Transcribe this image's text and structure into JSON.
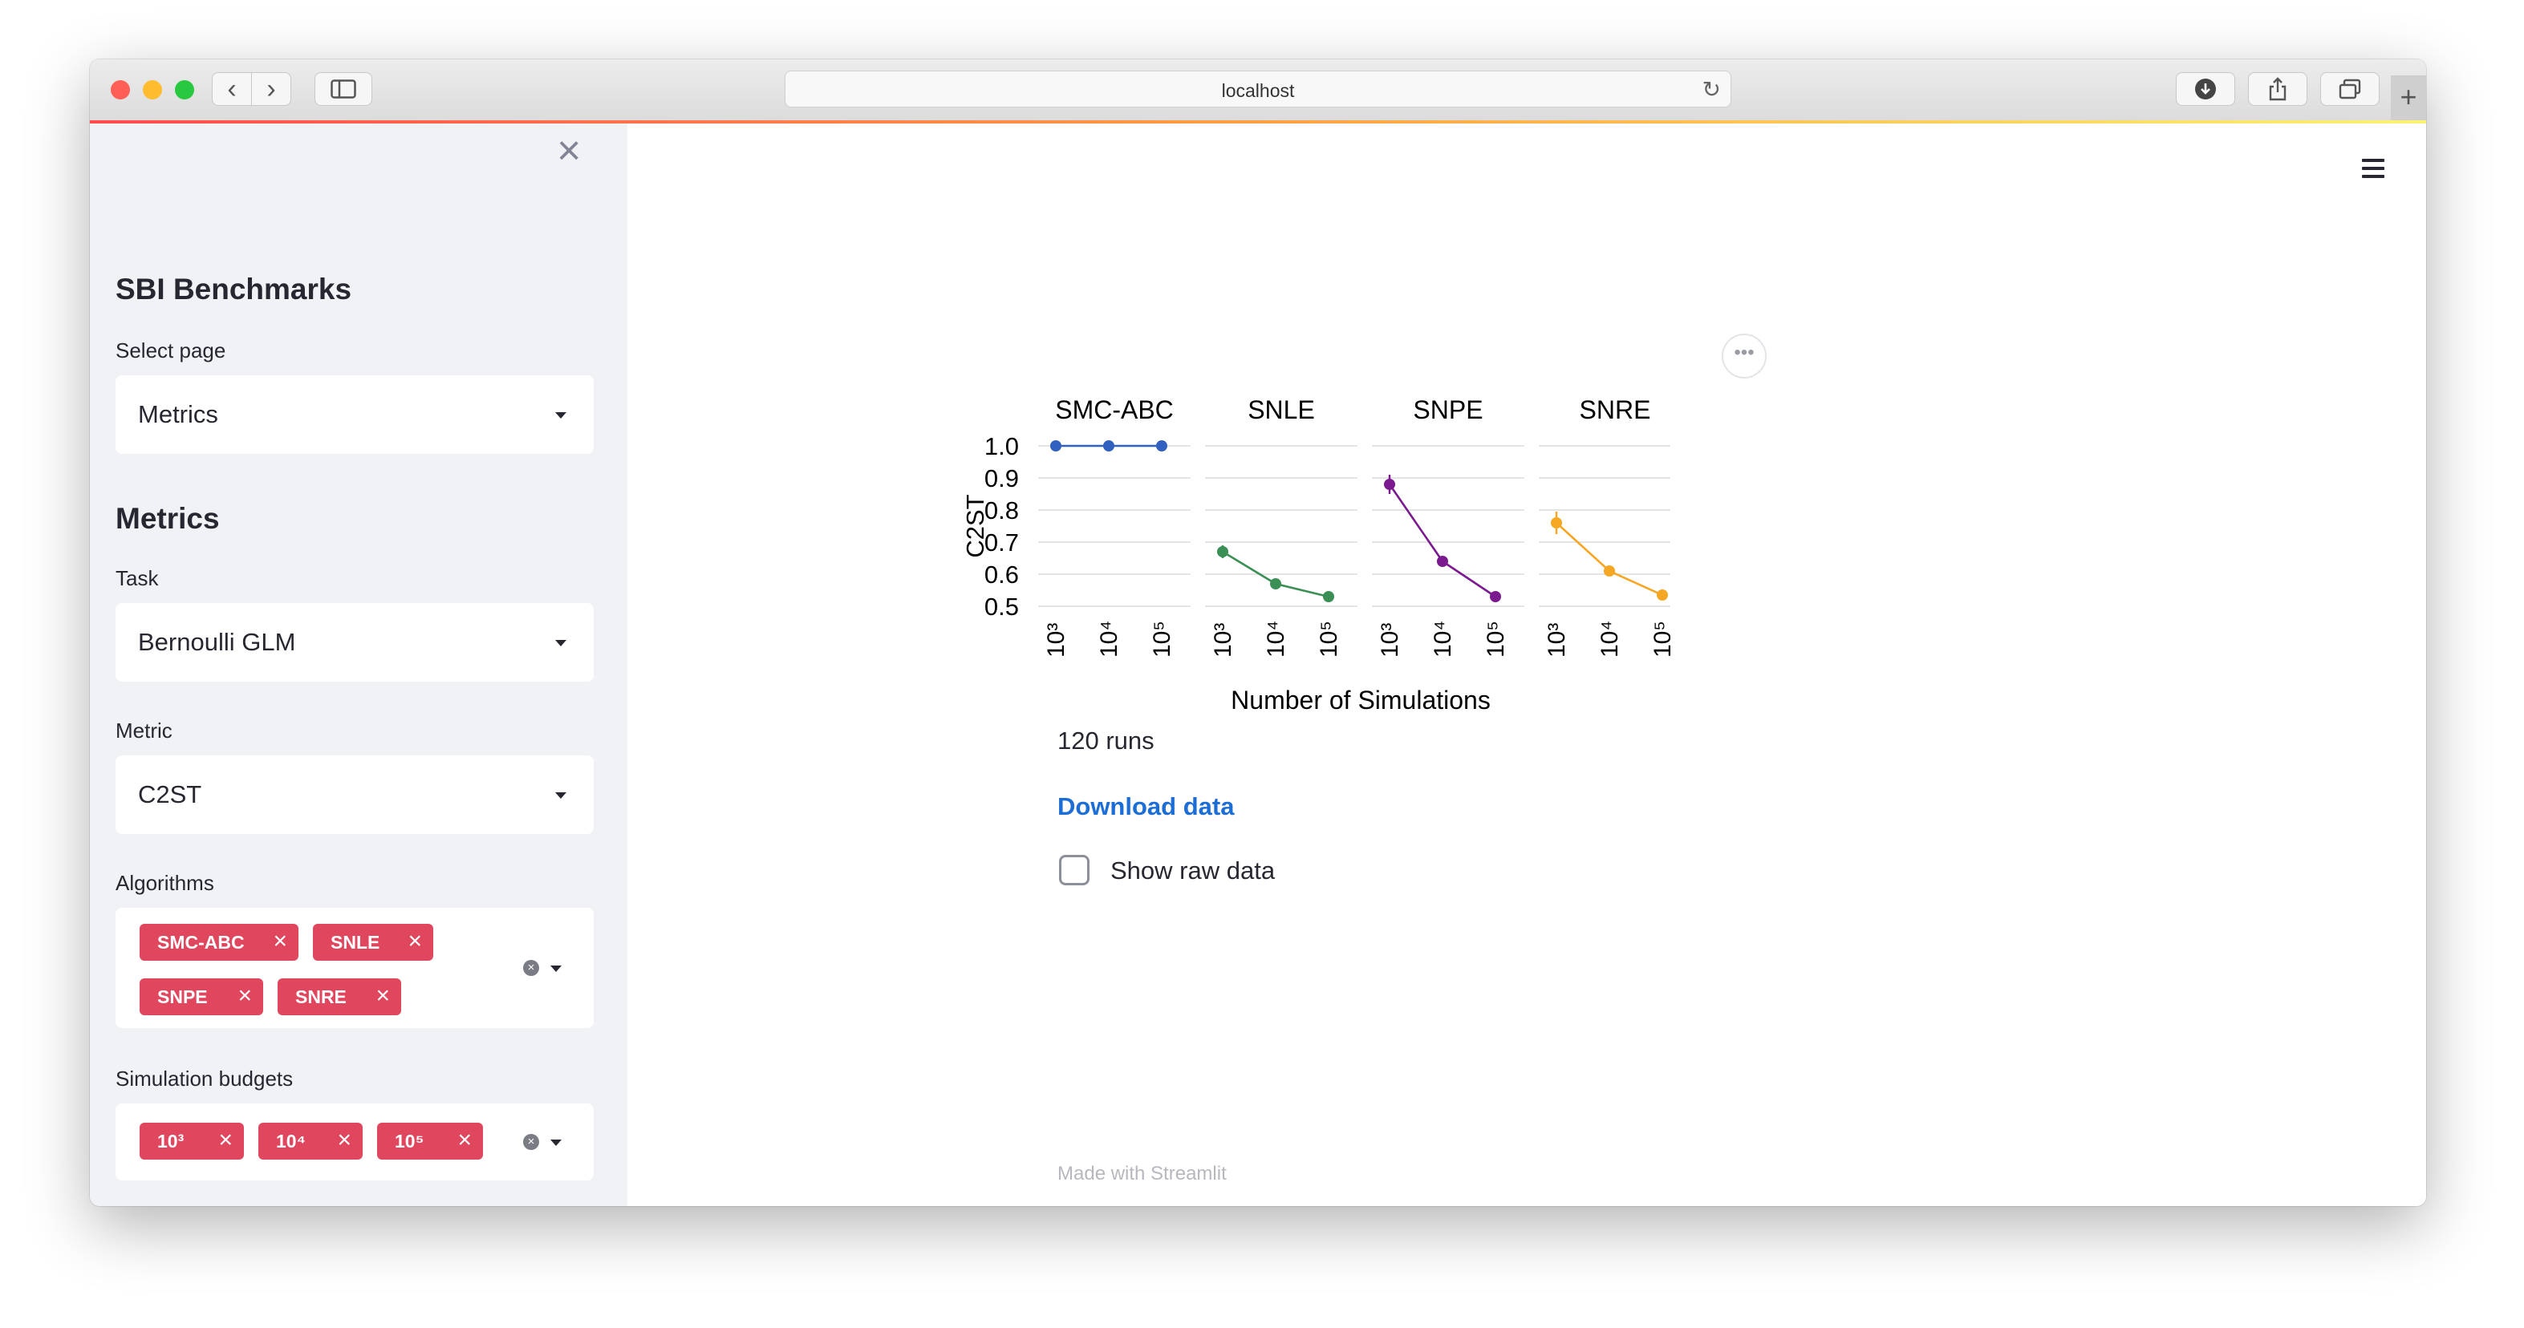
{
  "browser": {
    "url": "localhost",
    "traffic_lights": {
      "close": "#ff5f57",
      "minimize": "#febc2e",
      "zoom": "#28c840"
    },
    "buttons": {
      "back": "‹",
      "forward": "›",
      "reload": "↻",
      "new_tab": "+"
    }
  },
  "sidebar": {
    "close": "×",
    "title": "SBI Benchmarks",
    "select_page_label": "Select page",
    "select_page_value": "Metrics",
    "section_title": "Metrics",
    "task_label": "Task",
    "task_value": "Bernoulli GLM",
    "metric_label": "Metric",
    "metric_value": "C2ST",
    "algorithms_label": "Algorithms",
    "algorithms": [
      "SMC-ABC",
      "SNLE",
      "SNPE",
      "SNRE"
    ],
    "budgets_label": "Simulation budgets",
    "budgets": [
      "10³",
      "10⁴",
      "10⁵"
    ],
    "tag_color": "#e0475e",
    "tag_remove": "×"
  },
  "main": {
    "runs": "120 runs",
    "download": "Download data",
    "show_raw": "Show raw data",
    "footer": "Made with Streamlit",
    "more": "•••"
  },
  "chart_data": {
    "type": "line",
    "panels": [
      {
        "name": "SMC-ABC",
        "color": "#3060c0",
        "values": [
          1.0,
          1.0,
          1.0
        ],
        "error": [
          0,
          0,
          0
        ]
      },
      {
        "name": "SNLE",
        "color": "#3a8f55",
        "values": [
          0.67,
          0.57,
          0.53
        ],
        "error": [
          0.02,
          0.005,
          0.005
        ]
      },
      {
        "name": "SNPE",
        "color": "#7b1a8e",
        "values": [
          0.88,
          0.64,
          0.53
        ],
        "error": [
          0.03,
          0.015,
          0.005
        ]
      },
      {
        "name": "SNRE",
        "color": "#f5a623",
        "values": [
          0.76,
          0.61,
          0.535
        ],
        "error": [
          0.035,
          0.008,
          0.005
        ]
      }
    ],
    "x": [
      "10³",
      "10⁴",
      "10⁵"
    ],
    "yticks": [
      "1.0",
      "0.9",
      "0.8",
      "0.7",
      "0.6",
      "0.5"
    ],
    "ylim": [
      0.5,
      1.0
    ],
    "ylabel": "C2ST",
    "xlabel": "Number of Simulations",
    "grid": true
  }
}
